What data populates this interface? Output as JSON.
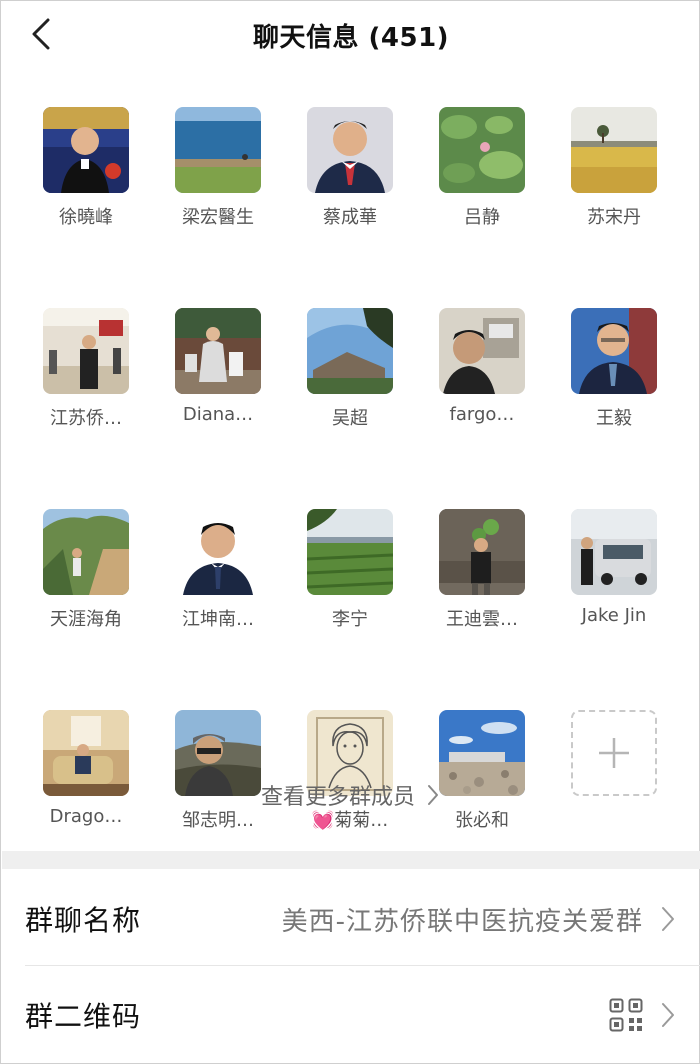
{
  "header": {
    "title": "聊天信息 (451)",
    "back_icon": "chevron-left-icon"
  },
  "members": [
    {
      "name": "徐曉峰",
      "avatar": "man-tuxedo-photo"
    },
    {
      "name": "梁宏醫生",
      "avatar": "lake-shore-photo"
    },
    {
      "name": "蔡成華",
      "avatar": "man-suit-photo"
    },
    {
      "name": "吕静",
      "avatar": "lotus-leaves-photo"
    },
    {
      "name": "苏宋丹",
      "avatar": "wheat-field-photo"
    },
    {
      "name": "江苏侨…",
      "avatar": "banquet-hall-photo"
    },
    {
      "name": "Diana…",
      "avatar": "woman-shopping-photo"
    },
    {
      "name": "吴超",
      "avatar": "sky-building-photo"
    },
    {
      "name": "fargo…",
      "avatar": "man-selfie-office-photo"
    },
    {
      "name": "王毅",
      "avatar": "man-glasses-suit-photo"
    },
    {
      "name": "天涯海角",
      "avatar": "desert-trail-photo"
    },
    {
      "name": "江坤南…",
      "avatar": "man-portrait-photo"
    },
    {
      "name": "李宁",
      "avatar": "vineyard-photo"
    },
    {
      "name": "王迪雲…",
      "avatar": "man-wall-photo"
    },
    {
      "name": "Jake Jin",
      "avatar": "man-van-photo"
    },
    {
      "name": "Drago…",
      "avatar": "man-armchair-photo"
    },
    {
      "name": "邹志明…",
      "avatar": "man-cap-mountain-photo"
    },
    {
      "name": "💓菊菊…",
      "avatar": "sketch-portrait-drawing"
    },
    {
      "name": "张必和",
      "avatar": "rocky-coast-photo"
    }
  ],
  "add_member": {
    "icon": "plus-icon"
  },
  "more_members": {
    "label": "查看更多群成员",
    "icon": "chevron-right-icon"
  },
  "settings": {
    "group_name_label": "群聊名称",
    "group_name_value": "美西-江苏侨联中医抗疫关爱群",
    "qr_label": "群二维码",
    "qr_icon": "qr-code-icon"
  }
}
